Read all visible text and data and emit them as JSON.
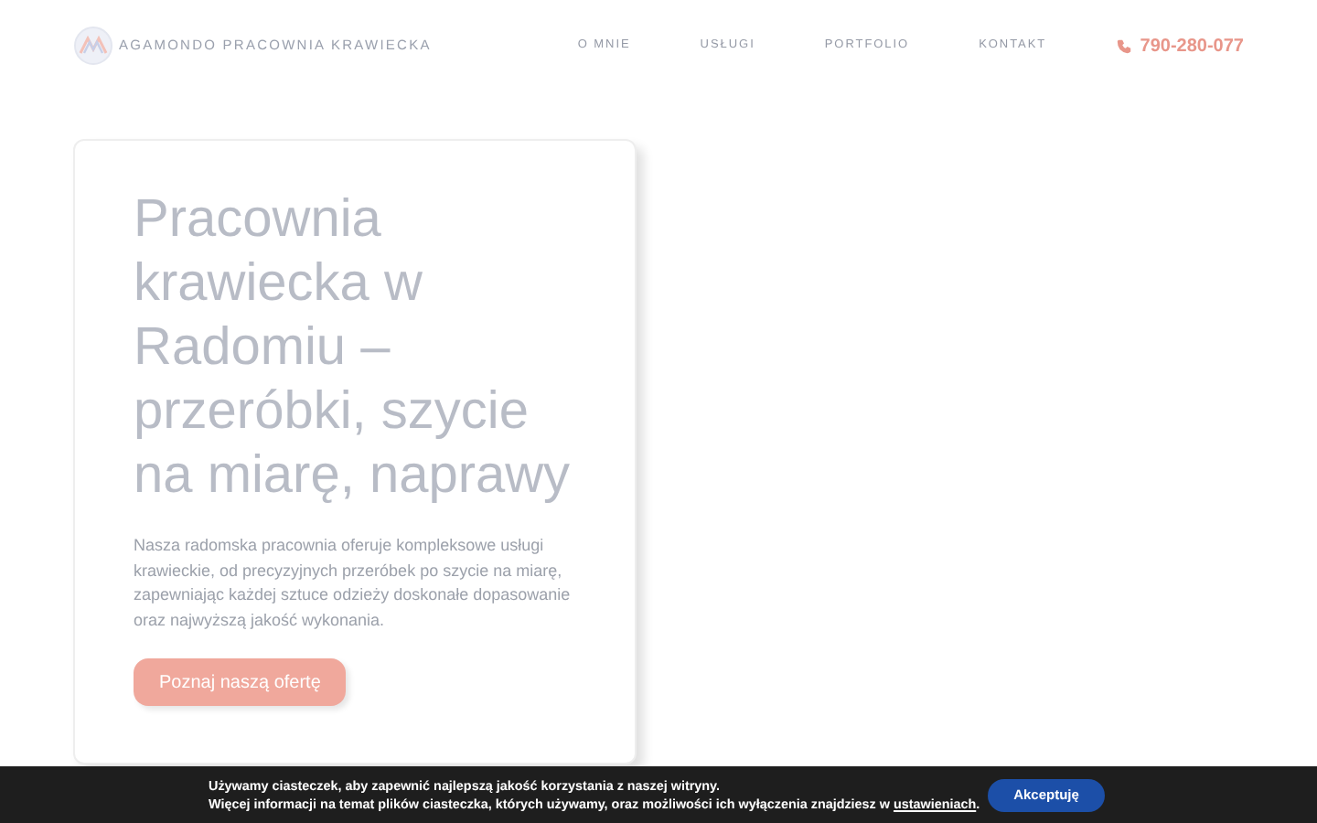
{
  "header": {
    "brand": "AGAMONDO PRACOWNIA KRAWIECKA",
    "nav": [
      {
        "label": "O MNIE"
      },
      {
        "label": "USŁUGI"
      },
      {
        "label": "PORTFOLIO"
      },
      {
        "label": "KONTAKT"
      }
    ],
    "phone": "790-280-077"
  },
  "hero": {
    "title": "Pracownia krawiecka w Radomiu – przeróbki, szycie na miarę, naprawy",
    "text": "Nasza radomska pracownia oferuje kompleksowe usługi krawieckie, od precyzyjnych przeróbek po szycie na miarę, zapewniając każdej sztuce odzieży doskonałe dopasowanie oraz najwyższą jakość wykonania.",
    "button": "Poznaj naszą ofertę"
  },
  "cookie_bar": {
    "line_1": "Używamy ciasteczek, aby zapewnić najlepszą jakość korzystania z naszej witryny.",
    "line_2": "Więcej informacji na temat plików ciasteczka, których używamy, oraz możliwości ich wyłączenia znajdziesz w",
    "link": "ustawieniach",
    "line_2_end": ".",
    "button": "Akceptuję"
  }
}
